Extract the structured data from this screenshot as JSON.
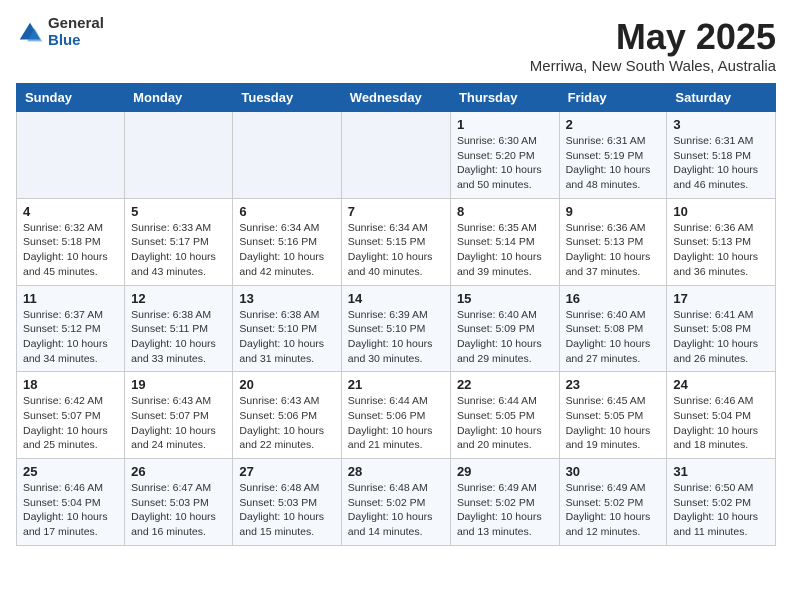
{
  "header": {
    "logo_general": "General",
    "logo_blue": "Blue",
    "title": "May 2025",
    "subtitle": "Merriwa, New South Wales, Australia"
  },
  "days_of_week": [
    "Sunday",
    "Monday",
    "Tuesday",
    "Wednesday",
    "Thursday",
    "Friday",
    "Saturday"
  ],
  "weeks": [
    [
      {
        "day": "",
        "info": ""
      },
      {
        "day": "",
        "info": ""
      },
      {
        "day": "",
        "info": ""
      },
      {
        "day": "",
        "info": ""
      },
      {
        "day": "1",
        "info": "Sunrise: 6:30 AM\nSunset: 5:20 PM\nDaylight: 10 hours\nand 50 minutes."
      },
      {
        "day": "2",
        "info": "Sunrise: 6:31 AM\nSunset: 5:19 PM\nDaylight: 10 hours\nand 48 minutes."
      },
      {
        "day": "3",
        "info": "Sunrise: 6:31 AM\nSunset: 5:18 PM\nDaylight: 10 hours\nand 46 minutes."
      }
    ],
    [
      {
        "day": "4",
        "info": "Sunrise: 6:32 AM\nSunset: 5:18 PM\nDaylight: 10 hours\nand 45 minutes."
      },
      {
        "day": "5",
        "info": "Sunrise: 6:33 AM\nSunset: 5:17 PM\nDaylight: 10 hours\nand 43 minutes."
      },
      {
        "day": "6",
        "info": "Sunrise: 6:34 AM\nSunset: 5:16 PM\nDaylight: 10 hours\nand 42 minutes."
      },
      {
        "day": "7",
        "info": "Sunrise: 6:34 AM\nSunset: 5:15 PM\nDaylight: 10 hours\nand 40 minutes."
      },
      {
        "day": "8",
        "info": "Sunrise: 6:35 AM\nSunset: 5:14 PM\nDaylight: 10 hours\nand 39 minutes."
      },
      {
        "day": "9",
        "info": "Sunrise: 6:36 AM\nSunset: 5:13 PM\nDaylight: 10 hours\nand 37 minutes."
      },
      {
        "day": "10",
        "info": "Sunrise: 6:36 AM\nSunset: 5:13 PM\nDaylight: 10 hours\nand 36 minutes."
      }
    ],
    [
      {
        "day": "11",
        "info": "Sunrise: 6:37 AM\nSunset: 5:12 PM\nDaylight: 10 hours\nand 34 minutes."
      },
      {
        "day": "12",
        "info": "Sunrise: 6:38 AM\nSunset: 5:11 PM\nDaylight: 10 hours\nand 33 minutes."
      },
      {
        "day": "13",
        "info": "Sunrise: 6:38 AM\nSunset: 5:10 PM\nDaylight: 10 hours\nand 31 minutes."
      },
      {
        "day": "14",
        "info": "Sunrise: 6:39 AM\nSunset: 5:10 PM\nDaylight: 10 hours\nand 30 minutes."
      },
      {
        "day": "15",
        "info": "Sunrise: 6:40 AM\nSunset: 5:09 PM\nDaylight: 10 hours\nand 29 minutes."
      },
      {
        "day": "16",
        "info": "Sunrise: 6:40 AM\nSunset: 5:08 PM\nDaylight: 10 hours\nand 27 minutes."
      },
      {
        "day": "17",
        "info": "Sunrise: 6:41 AM\nSunset: 5:08 PM\nDaylight: 10 hours\nand 26 minutes."
      }
    ],
    [
      {
        "day": "18",
        "info": "Sunrise: 6:42 AM\nSunset: 5:07 PM\nDaylight: 10 hours\nand 25 minutes."
      },
      {
        "day": "19",
        "info": "Sunrise: 6:43 AM\nSunset: 5:07 PM\nDaylight: 10 hours\nand 24 minutes."
      },
      {
        "day": "20",
        "info": "Sunrise: 6:43 AM\nSunset: 5:06 PM\nDaylight: 10 hours\nand 22 minutes."
      },
      {
        "day": "21",
        "info": "Sunrise: 6:44 AM\nSunset: 5:06 PM\nDaylight: 10 hours\nand 21 minutes."
      },
      {
        "day": "22",
        "info": "Sunrise: 6:44 AM\nSunset: 5:05 PM\nDaylight: 10 hours\nand 20 minutes."
      },
      {
        "day": "23",
        "info": "Sunrise: 6:45 AM\nSunset: 5:05 PM\nDaylight: 10 hours\nand 19 minutes."
      },
      {
        "day": "24",
        "info": "Sunrise: 6:46 AM\nSunset: 5:04 PM\nDaylight: 10 hours\nand 18 minutes."
      }
    ],
    [
      {
        "day": "25",
        "info": "Sunrise: 6:46 AM\nSunset: 5:04 PM\nDaylight: 10 hours\nand 17 minutes."
      },
      {
        "day": "26",
        "info": "Sunrise: 6:47 AM\nSunset: 5:03 PM\nDaylight: 10 hours\nand 16 minutes."
      },
      {
        "day": "27",
        "info": "Sunrise: 6:48 AM\nSunset: 5:03 PM\nDaylight: 10 hours\nand 15 minutes."
      },
      {
        "day": "28",
        "info": "Sunrise: 6:48 AM\nSunset: 5:02 PM\nDaylight: 10 hours\nand 14 minutes."
      },
      {
        "day": "29",
        "info": "Sunrise: 6:49 AM\nSunset: 5:02 PM\nDaylight: 10 hours\nand 13 minutes."
      },
      {
        "day": "30",
        "info": "Sunrise: 6:49 AM\nSunset: 5:02 PM\nDaylight: 10 hours\nand 12 minutes."
      },
      {
        "day": "31",
        "info": "Sunrise: 6:50 AM\nSunset: 5:02 PM\nDaylight: 10 hours\nand 11 minutes."
      }
    ]
  ]
}
